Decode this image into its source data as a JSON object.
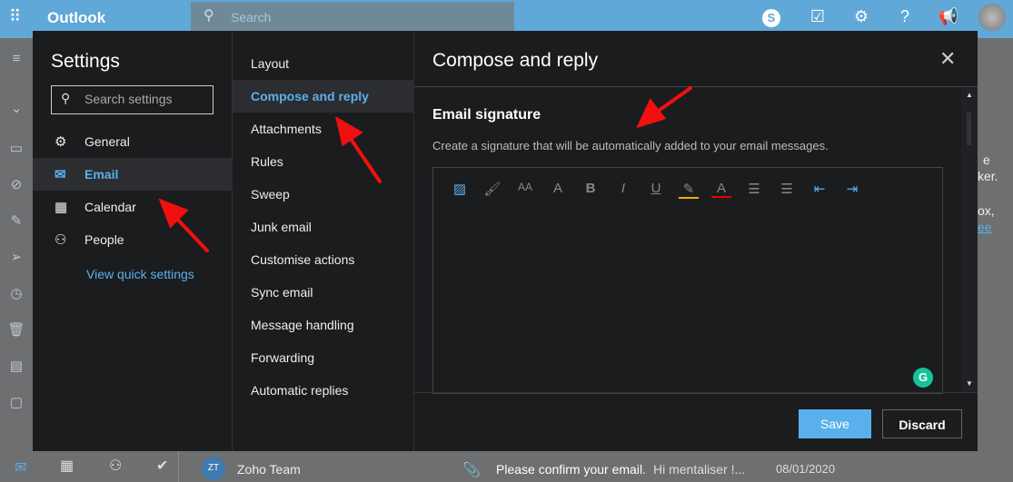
{
  "app": {
    "title": "Outlook",
    "search_placeholder": "Search"
  },
  "topbar_icons": [
    "skype-icon",
    "calendar-check-icon",
    "gear-icon",
    "help-icon",
    "megaphone-icon"
  ],
  "settings": {
    "title": "Settings",
    "search_placeholder": "Search settings",
    "nav": [
      {
        "label": "General",
        "icon": "⚙"
      },
      {
        "label": "Email",
        "icon": "✉"
      },
      {
        "label": "Calendar",
        "icon": "▦"
      },
      {
        "label": "People",
        "icon": "⚇"
      }
    ],
    "quick_link": "View quick settings",
    "subnav": [
      "Layout",
      "Compose and reply",
      "Attachments",
      "Rules",
      "Sweep",
      "Junk email",
      "Customise actions",
      "Sync email",
      "Message handling",
      "Forwarding",
      "Automatic replies"
    ],
    "panel_title": "Compose and reply",
    "section_title": "Email signature",
    "section_desc": "Create a signature that will be automatically added to your email messages.",
    "save": "Save",
    "discard": "Discard"
  },
  "background_fragments": [
    "e",
    "ker.",
    "ox,",
    "ee"
  ],
  "message": {
    "initials": "ZT",
    "sender": "Zoho Team",
    "subject": "Please confirm your email.",
    "preview": "Hi mentaliser !...",
    "date": "08/01/2020"
  }
}
